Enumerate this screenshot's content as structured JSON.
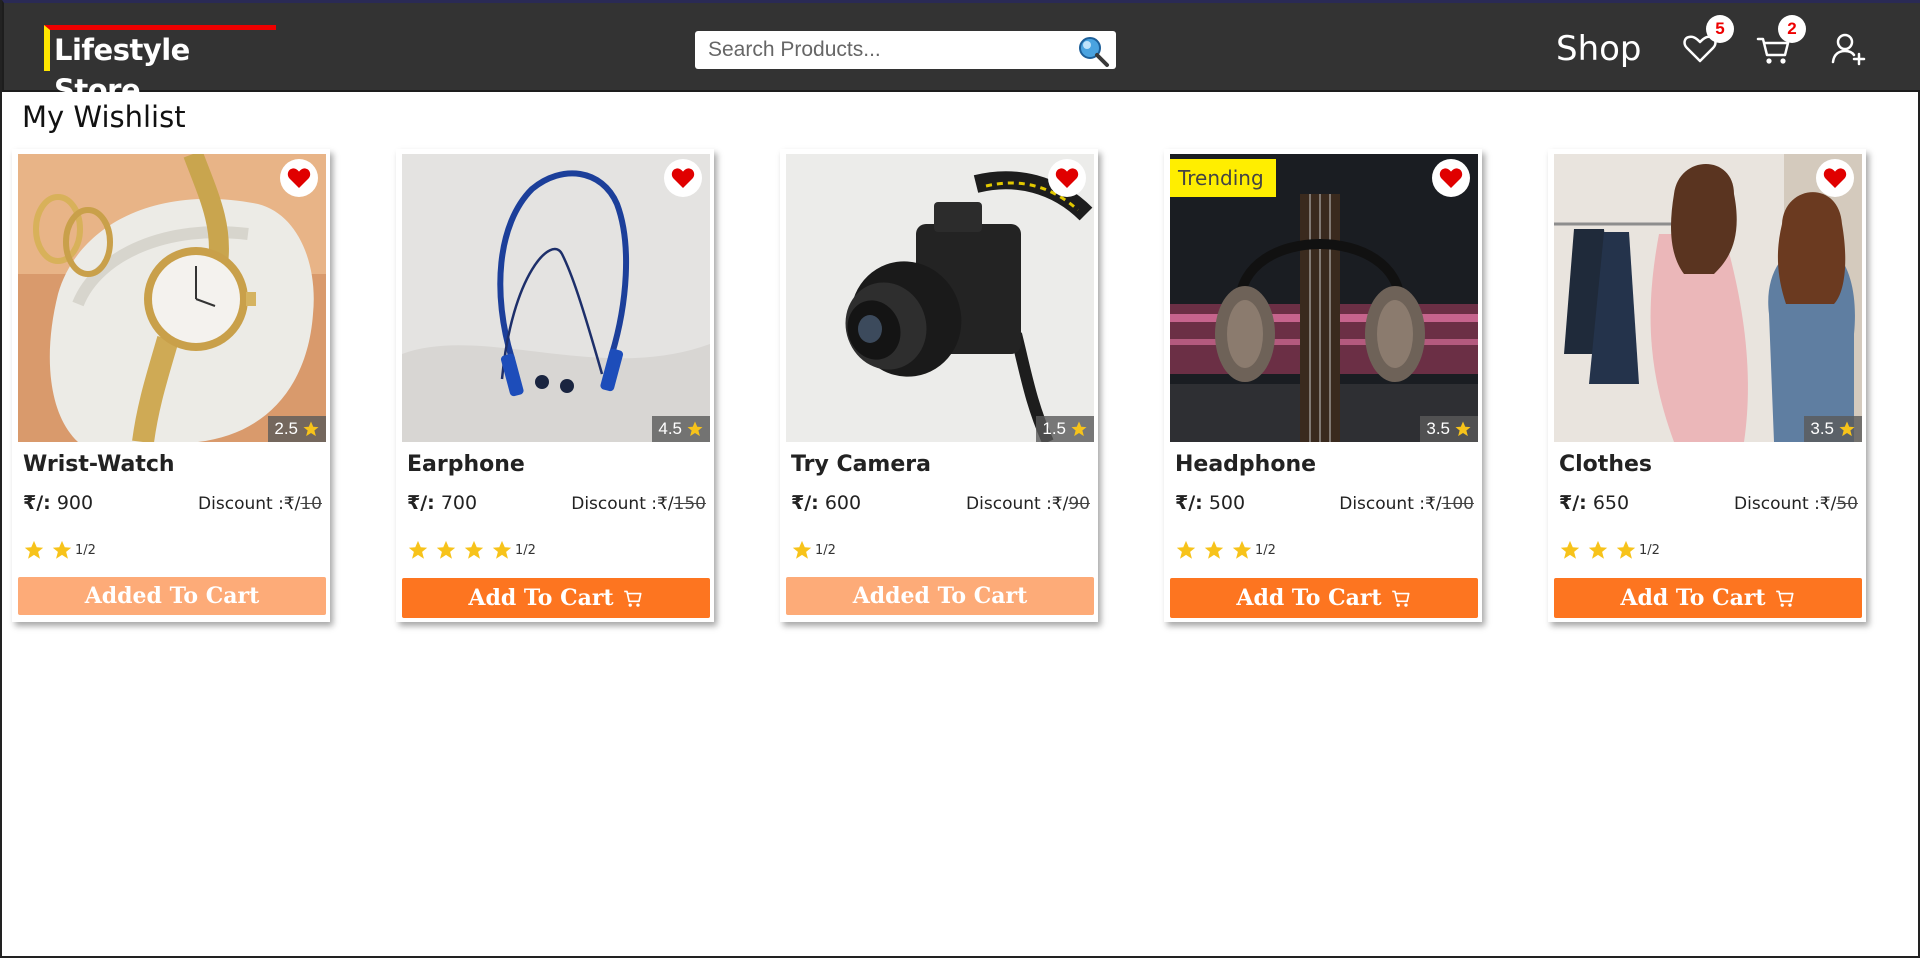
{
  "brand": {
    "name": "Lifestyle Store"
  },
  "search": {
    "placeholder": "Search Products..."
  },
  "nav": {
    "shop_label": "Shop",
    "wishlist_count": "5",
    "cart_count": "2"
  },
  "page": {
    "title": "My Wishlist"
  },
  "currency_label": "₹/:",
  "discount_label": "Discount :₹/",
  "colors": {
    "navbar": "#333333",
    "accent_orange": "#fd7520",
    "added_orange": "#fdab78",
    "trending_yellow": "#ffee00",
    "heart_red": "#e00000",
    "star_gold": "#f7c31a"
  },
  "products": [
    {
      "name": "Wrist-Watch",
      "price": "900",
      "discount": "10",
      "rating": "2.5",
      "stars": 2,
      "half_label": "1/2",
      "button_label": "Added To Cart",
      "added": true,
      "trending": false,
      "image": "wrist-watch-photo"
    },
    {
      "name": "Earphone",
      "price": "700",
      "discount": "150",
      "rating": "4.5",
      "stars": 4,
      "half_label": "1/2",
      "button_label": "Add To Cart",
      "added": false,
      "trending": false,
      "image": "earphone-photo"
    },
    {
      "name": "Try Camera",
      "price": "600",
      "discount": "90",
      "rating": "1.5",
      "stars": 1,
      "half_label": "1/2",
      "button_label": "Added To Cart",
      "added": true,
      "trending": false,
      "image": "camera-photo"
    },
    {
      "name": "Headphone",
      "price": "500",
      "discount": "100",
      "rating": "3.5",
      "stars": 3,
      "half_label": "1/2",
      "button_label": "Add To Cart",
      "added": false,
      "trending": true,
      "trending_label": "Trending",
      "image": "headphone-photo"
    },
    {
      "name": "Clothes",
      "price": "650",
      "discount": "50",
      "rating": "3.5",
      "stars": 3,
      "half_label": "1/2",
      "button_label": "Add To Cart",
      "added": false,
      "trending": false,
      "image": "clothes-photo"
    }
  ]
}
